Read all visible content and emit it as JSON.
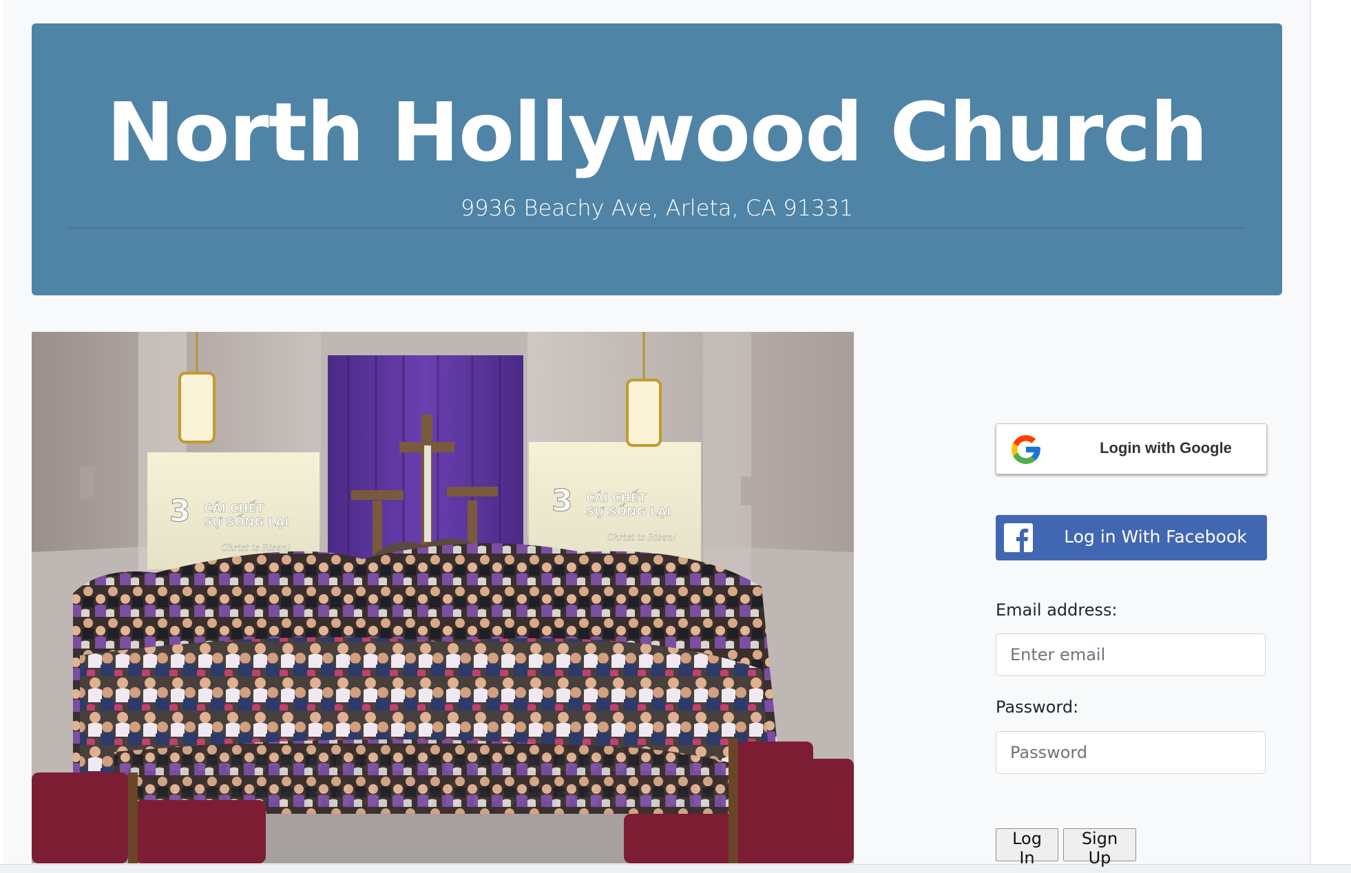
{
  "header": {
    "title": "North Hollywood Church",
    "address": "9936 Beachy Ave, Arleta, CA 91331"
  },
  "photo": {
    "banner_line1": "CÁI CHẾT",
    "banner_line2": "SỰ SỐNG LẠI",
    "banner_number": "3",
    "banner_tag": "Christ is Risen!"
  },
  "auth": {
    "google_label": "Login with Google",
    "facebook_label": "Log in With Facebook",
    "email_label": "Email address:",
    "email_placeholder": "Enter email",
    "password_label": "Password:",
    "password_placeholder": "Password",
    "login_label": "Log In",
    "signup_label": "Sign Up"
  },
  "colors": {
    "jumbotron": "#4f84a6",
    "facebook": "#4267b2",
    "page_background": "#f8f9fa"
  },
  "icons": {
    "google": "google-g-icon",
    "facebook": "facebook-f-icon"
  }
}
